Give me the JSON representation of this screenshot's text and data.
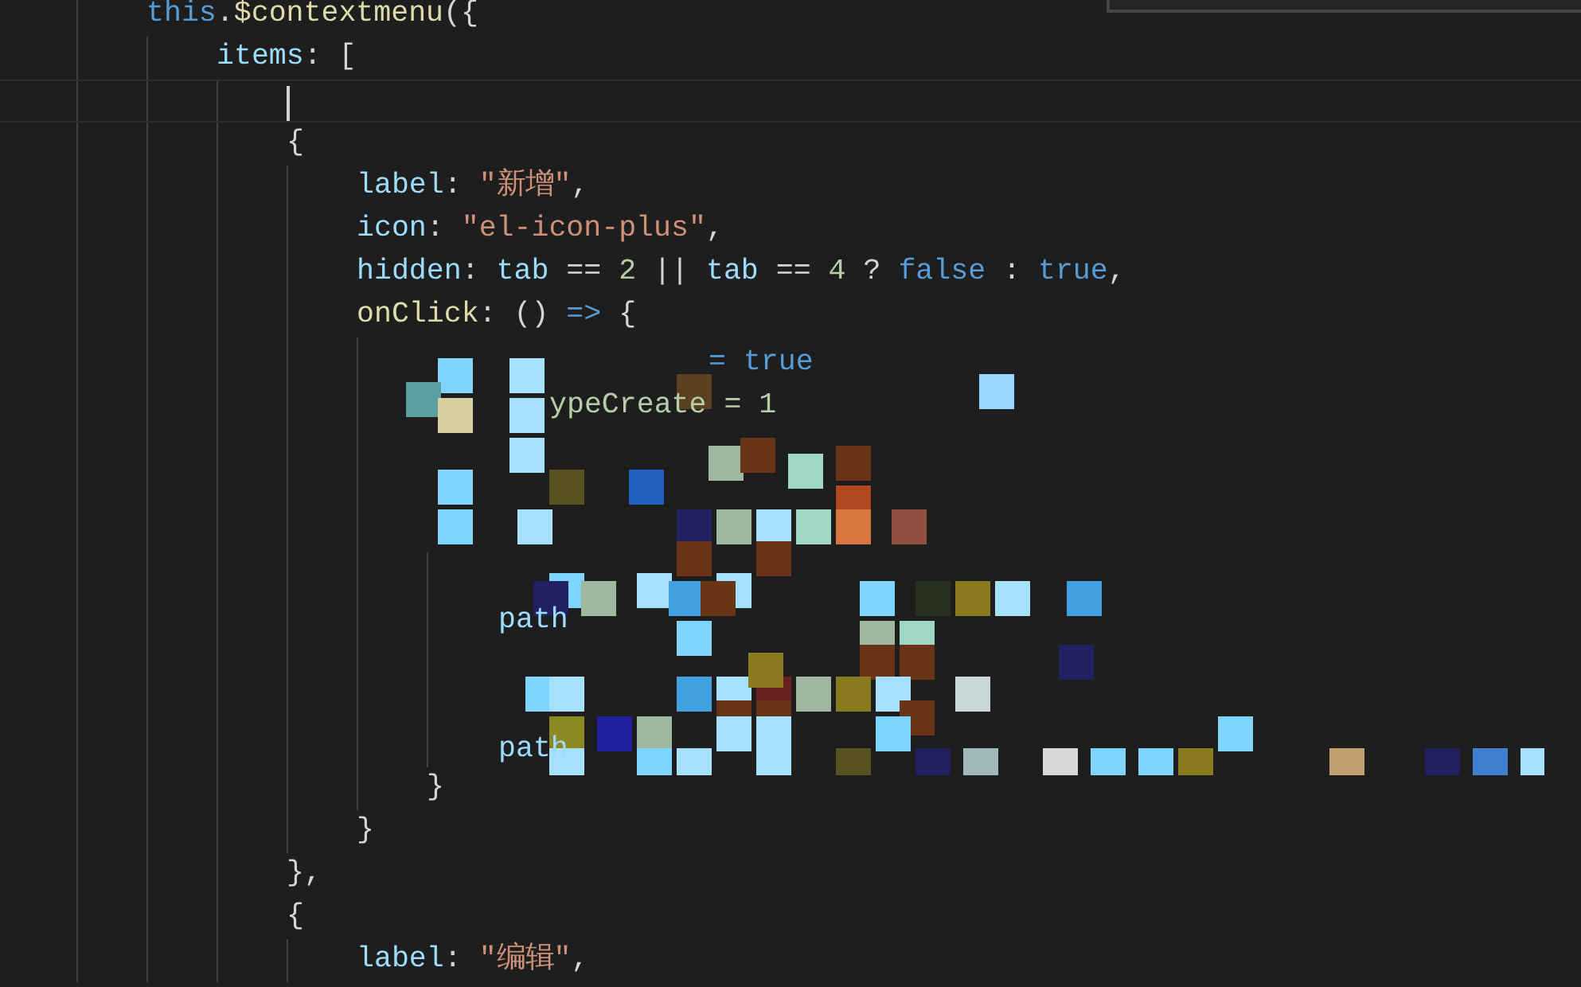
{
  "code_lines": [
    {
      "tokens": [
        {
          "text": "this",
          "kind": "keyword"
        },
        {
          "text": ".",
          "kind": "plain"
        },
        {
          "text": "$contextmenu",
          "kind": "function"
        },
        {
          "text": "({",
          "kind": "plain"
        }
      ],
      "children": [
        {
          "tokens": [
            {
              "text": "items",
              "kind": "property"
            },
            {
              "text": ": [",
              "kind": "plain"
            }
          ],
          "children": [
            {
              "current": true
            },
            {
              "tokens": [
                {
                  "text": "{",
                  "kind": "plain"
                }
              ],
              "children": [
                {
                  "tokens": [
                    {
                      "text": "label",
                      "kind": "property"
                    },
                    {
                      "text": ": ",
                      "kind": "plain"
                    },
                    {
                      "text": "\"新增\"",
                      "kind": "string"
                    },
                    {
                      "text": ",",
                      "kind": "plain"
                    }
                  ]
                },
                {
                  "tokens": [
                    {
                      "text": "icon",
                      "kind": "property"
                    },
                    {
                      "text": ": ",
                      "kind": "plain"
                    },
                    {
                      "text": "\"el-icon-plus\"",
                      "kind": "string"
                    },
                    {
                      "text": ",",
                      "kind": "plain"
                    }
                  ]
                },
                {
                  "tokens": [
                    {
                      "text": "hidden",
                      "kind": "property"
                    },
                    {
                      "text": ": ",
                      "kind": "plain"
                    },
                    {
                      "text": "tab",
                      "kind": "property"
                    },
                    {
                      "text": " == ",
                      "kind": "plain"
                    },
                    {
                      "text": "2",
                      "kind": "number"
                    },
                    {
                      "text": " || ",
                      "kind": "plain"
                    },
                    {
                      "text": "tab",
                      "kind": "property"
                    },
                    {
                      "text": " == ",
                      "kind": "plain"
                    },
                    {
                      "text": "4",
                      "kind": "number"
                    },
                    {
                      "text": " ? ",
                      "kind": "plain"
                    },
                    {
                      "text": "false",
                      "kind": "keyword"
                    },
                    {
                      "text": " : ",
                      "kind": "plain"
                    },
                    {
                      "text": "true",
                      "kind": "keyword"
                    },
                    {
                      "text": ",",
                      "kind": "plain"
                    }
                  ]
                },
                {
                  "tokens": [
                    {
                      "text": "onClick",
                      "kind": "function"
                    },
                    {
                      "text": ": () ",
                      "kind": "plain"
                    },
                    {
                      "text": "=>",
                      "kind": "keyword"
                    },
                    {
                      "text": " {",
                      "kind": "plain"
                    }
                  ],
                  "children": [
                    {
                      "current": false
                    },
                    {
                      "current": false
                    },
                    {
                      "current": false
                    },
                    {
                      "current": false
                    },
                    {
                      "current": false,
                      "children": [
                        {
                          "current": false
                        },
                        {
                          "current": false
                        },
                        {
                          "current": false
                        },
                        {
                          "current": false
                        },
                        {
                          "current": false
                        }
                      ]
                    },
                    {
                      "tokens": [
                        {
                          "text": "}",
                          "kind": "plain"
                        }
                      ]
                    }
                  ]
                },
                {
                  "tokens": [
                    {
                      "text": "}",
                      "kind": "plain"
                    }
                  ]
                }
              ]
            },
            {
              "tokens": [
                {
                  "text": "},",
                  "kind": "plain"
                }
              ]
            },
            {
              "tokens": [
                {
                  "text": "{",
                  "kind": "plain"
                }
              ],
              "children": [
                {
                  "tokens": [
                    {
                      "text": "label",
                      "kind": "property"
                    },
                    {
                      "text": ": ",
                      "kind": "plain"
                    },
                    {
                      "text": "\"编辑\"",
                      "kind": "string"
                    },
                    {
                      "text": ",",
                      "kind": "plain"
                    }
                  ]
                }
              ]
            }
          ]
        }
      ]
    }
  ],
  "mosaic": {
    "fragments": [
      {
        "text": "= true",
        "kind": "keyword_tail"
      },
      {
        "text": "ypeCreate = 1",
        "kind": "number_tail"
      },
      {
        "text": "path",
        "kind": "property"
      },
      {
        "text": "path",
        "kind": "property"
      }
    ]
  }
}
